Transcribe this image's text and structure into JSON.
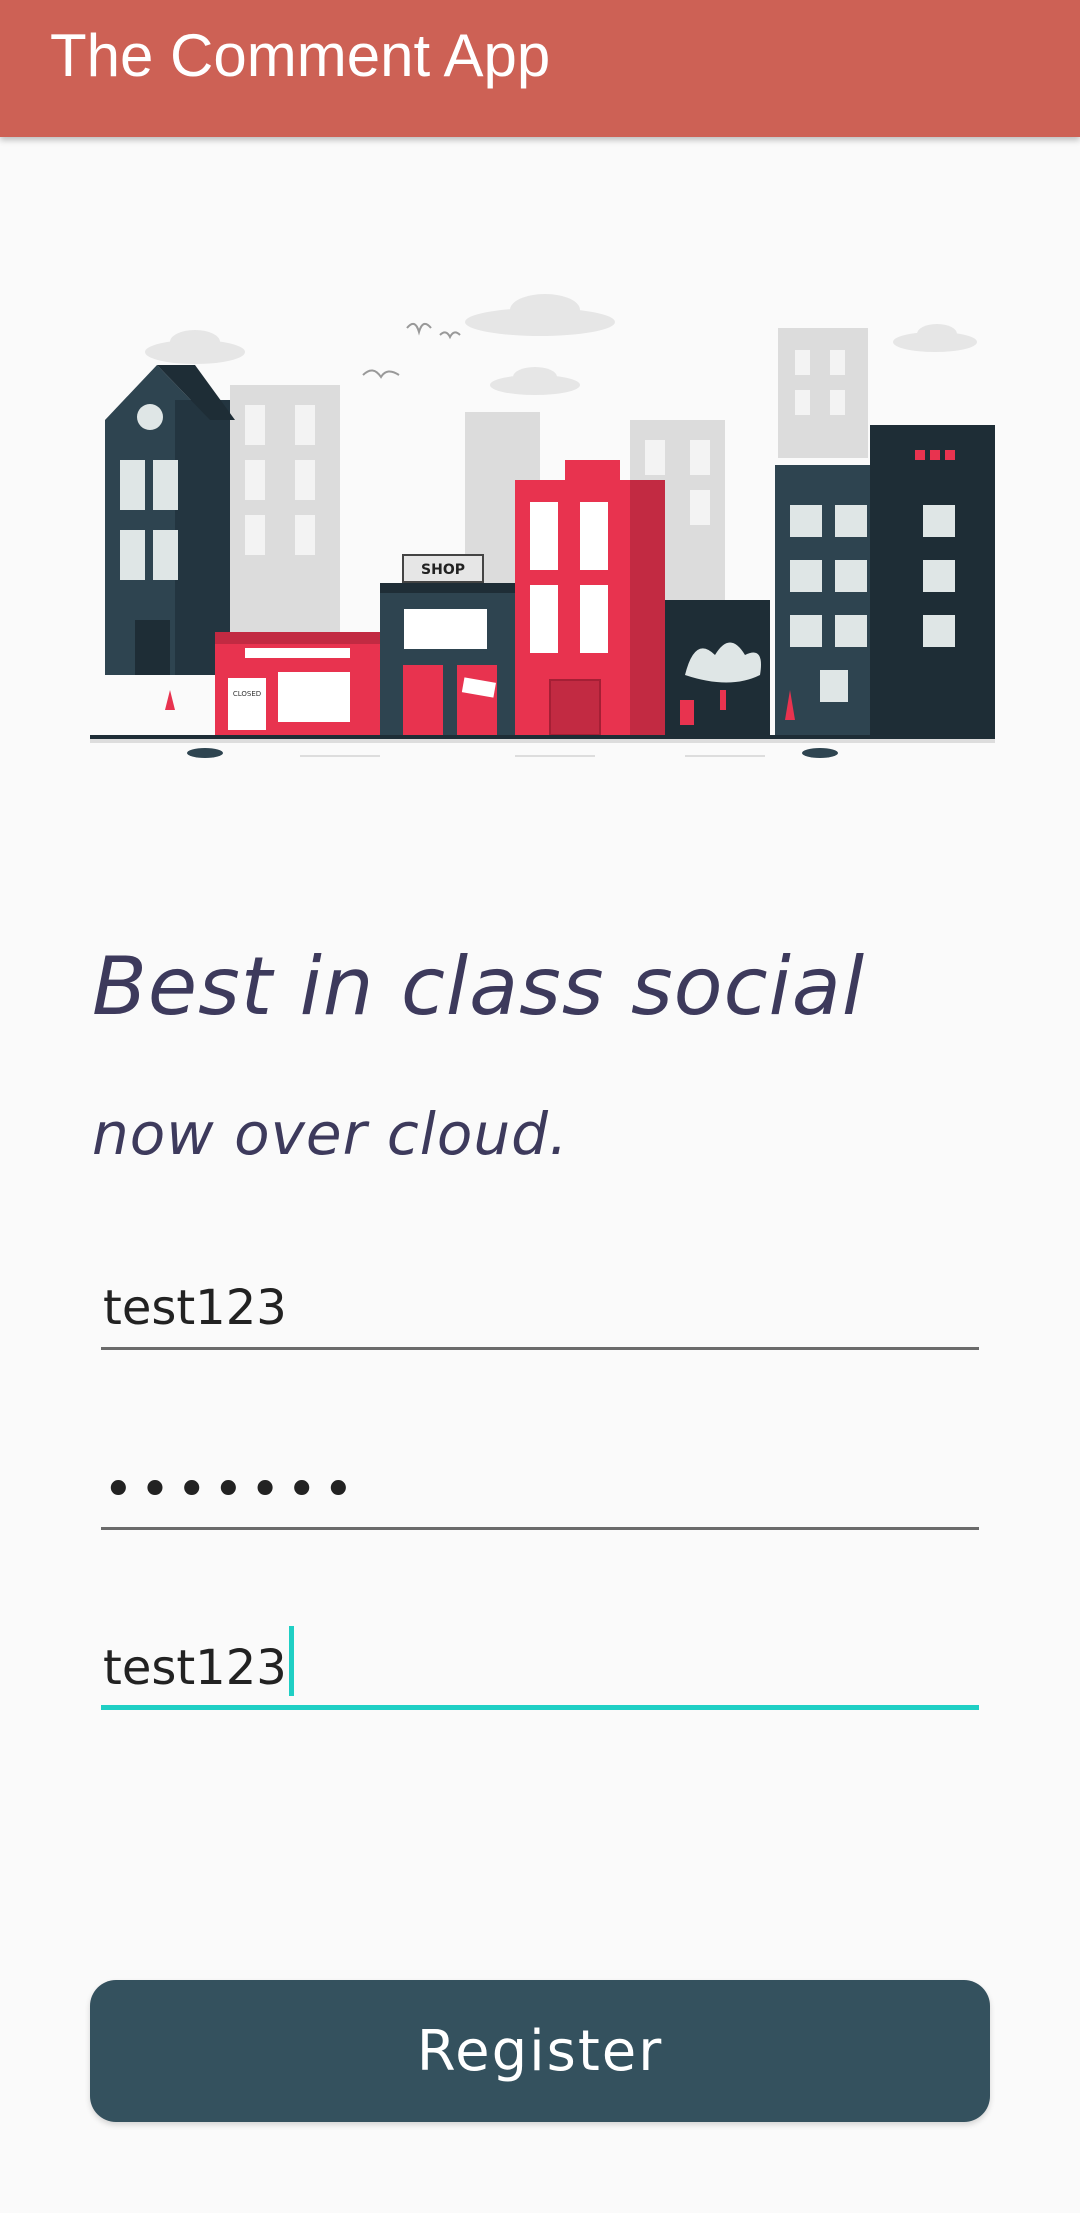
{
  "app_bar": {
    "title": "The Comment App"
  },
  "hero": {
    "shop_sign": "SHOP",
    "closed_sign": "CLOSED"
  },
  "tagline": {
    "line1": "Best in class social",
    "line2": "now over cloud."
  },
  "form": {
    "username": {
      "value": "test123"
    },
    "password": {
      "value": "•••••••"
    },
    "confirm": {
      "value": "test123"
    }
  },
  "register_button": {
    "label": "Register"
  },
  "colors": {
    "app_bar": "#cd6155",
    "button": "#34515e",
    "focus": "#1fcfc4",
    "accent_red": "#e8334f",
    "dark_building": "#2e4450"
  }
}
